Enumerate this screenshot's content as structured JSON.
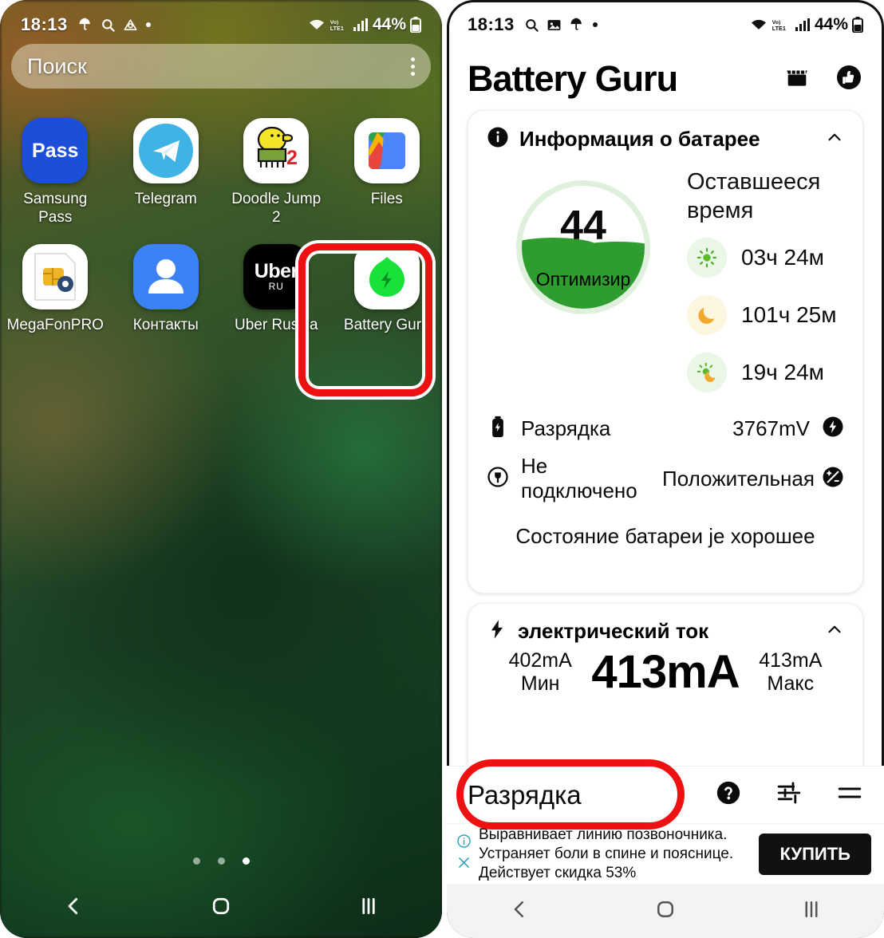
{
  "left_phone": {
    "status_bar": {
      "time": "18:13",
      "left_icons": [
        "umbrella-icon",
        "search-icon",
        "drive-icon",
        "dot-icon"
      ],
      "right_icons": [
        "wifi-icon",
        "volte-icon",
        "signal-icon"
      ],
      "battery_percent": "44%"
    },
    "search": {
      "placeholder": "Поиск",
      "overflow_icon": "more-vertical-icon"
    },
    "apps": [
      {
        "label": "Samsung Pass",
        "icon": "samsung-pass-icon",
        "mark": "Pass"
      },
      {
        "label": "Telegram",
        "icon": "telegram-icon"
      },
      {
        "label": "Doodle Jump 2",
        "icon": "doodle-jump-icon",
        "badge": "2"
      },
      {
        "label": "Files",
        "icon": "files-icon"
      },
      {
        "label": "MegaFonPRO",
        "icon": "megafon-pro-icon"
      },
      {
        "label": "Контакты",
        "icon": "contacts-icon"
      },
      {
        "label": "Uber Russia",
        "icon": "uber-icon",
        "mark": "Uber",
        "submark": "RU"
      },
      {
        "label": "Battery Guru",
        "icon": "battery-guru-icon",
        "highlighted": true
      }
    ],
    "page_dots": {
      "count": 3,
      "active_index": 2
    },
    "nav": [
      "back-icon",
      "home-icon",
      "recents-icon"
    ]
  },
  "right_phone": {
    "status_bar": {
      "time": "18:13",
      "left_icons": [
        "search-icon",
        "image-icon",
        "umbrella-icon",
        "dot-icon"
      ],
      "right_icons": [
        "wifi-icon",
        "volte-icon",
        "signal-icon"
      ],
      "battery_percent": "44%"
    },
    "header": {
      "title": "Battery Guru",
      "actions": [
        "store-icon",
        "thumbs-up-icon"
      ]
    },
    "battery_card": {
      "icon": "info-icon",
      "title": "Информация о батарее",
      "collapse_icon": "chevron-up-icon",
      "gauge": {
        "percent": "44",
        "state": "Оптимизир",
        "fill_color": "#2f9c2f",
        "ring_color": "#dff0dd"
      },
      "remaining_title": "Оставшееся время",
      "remaining": [
        {
          "icon": "sun-icon",
          "value": "03ч 24м",
          "badge_color": "#eaf7e6"
        },
        {
          "icon": "moon-icon",
          "value": "101ч 25м",
          "badge_color": "#fdf6df"
        },
        {
          "icon": "sun-moon-icon",
          "value": "19ч 24м",
          "badge_color": "#eaf7e6"
        }
      ],
      "rows": [
        {
          "left_icon": "battery-bolt-icon",
          "left_text": "Разрядка",
          "right_text": "3767mV",
          "right_icon": "bolt-circle-icon"
        },
        {
          "left_icon": "plug-circle-icon",
          "left_text": "Не подключено",
          "right_text": "Положительная",
          "right_icon": "polarity-icon"
        }
      ],
      "health_text": "Состояние батареи je хорошее"
    },
    "current_card": {
      "icon": "bolt-icon",
      "title": "электрический ток",
      "collapse_icon": "chevron-up-icon",
      "min_value": "402mA",
      "min_label": "Мин",
      "main_value": "413mA",
      "max_value": "413mA",
      "max_label": "Макс"
    },
    "bottom_bar": {
      "label": "Разрядка",
      "actions": [
        "help-icon",
        "tune-icon",
        "menu-icon"
      ]
    },
    "ad": {
      "info_icon": "info-circle-icon",
      "close_icon": "close-icon",
      "line1": "Выравнивает линию позвоночника.",
      "line2": "Устраняет боли в спине и пояснице.",
      "line3": "Действует скидка 53%",
      "button": "КУПИТЬ"
    },
    "nav": [
      "back-icon",
      "home-icon",
      "recents-icon"
    ]
  },
  "annotations": {
    "highlight_color": "#ee1111",
    "shapes": [
      "app-icon-highlight-rect",
      "bottom-label-highlight-oval"
    ]
  }
}
